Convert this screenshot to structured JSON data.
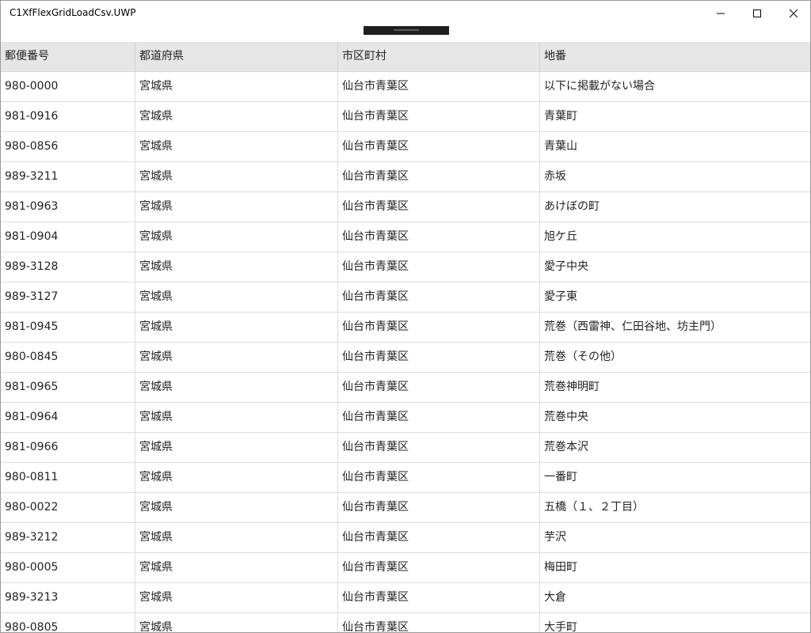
{
  "window": {
    "title": "C1XfFlexGridLoadCsv.UWP"
  },
  "icons": {
    "minimize": "minimize-icon",
    "maximize": "maximize-icon",
    "close": "close-icon"
  },
  "grid": {
    "columns": [
      "郵便番号",
      "都道府県",
      "市区町村",
      "地番"
    ],
    "rows": [
      [
        "980-0000",
        "宮城県",
        "仙台市青葉区",
        "以下に掲載がない場合"
      ],
      [
        "981-0916",
        "宮城県",
        "仙台市青葉区",
        "青葉町"
      ],
      [
        "980-0856",
        "宮城県",
        "仙台市青葉区",
        "青葉山"
      ],
      [
        "989-3211",
        "宮城県",
        "仙台市青葉区",
        "赤坂"
      ],
      [
        "981-0963",
        "宮城県",
        "仙台市青葉区",
        "あけぼの町"
      ],
      [
        "981-0904",
        "宮城県",
        "仙台市青葉区",
        "旭ケ丘"
      ],
      [
        "989-3128",
        "宮城県",
        "仙台市青葉区",
        "愛子中央"
      ],
      [
        "989-3127",
        "宮城県",
        "仙台市青葉区",
        "愛子東"
      ],
      [
        "981-0945",
        "宮城県",
        "仙台市青葉区",
        "荒巻（西雷神、仁田谷地、坊主門）"
      ],
      [
        "980-0845",
        "宮城県",
        "仙台市青葉区",
        "荒巻（その他）"
      ],
      [
        "981-0965",
        "宮城県",
        "仙台市青葉区",
        "荒巻神明町"
      ],
      [
        "981-0964",
        "宮城県",
        "仙台市青葉区",
        "荒巻中央"
      ],
      [
        "981-0966",
        "宮城県",
        "仙台市青葉区",
        "荒巻本沢"
      ],
      [
        "980-0811",
        "宮城県",
        "仙台市青葉区",
        "一番町"
      ],
      [
        "980-0022",
        "宮城県",
        "仙台市青葉区",
        "五橋（１、２丁目）"
      ],
      [
        "989-3212",
        "宮城県",
        "仙台市青葉区",
        "芋沢"
      ],
      [
        "980-0005",
        "宮城県",
        "仙台市青葉区",
        "梅田町"
      ],
      [
        "989-3213",
        "宮城県",
        "仙台市青葉区",
        "大倉"
      ],
      [
        "980-0805",
        "宮城県",
        "仙台市青葉区",
        "大手町"
      ]
    ]
  }
}
